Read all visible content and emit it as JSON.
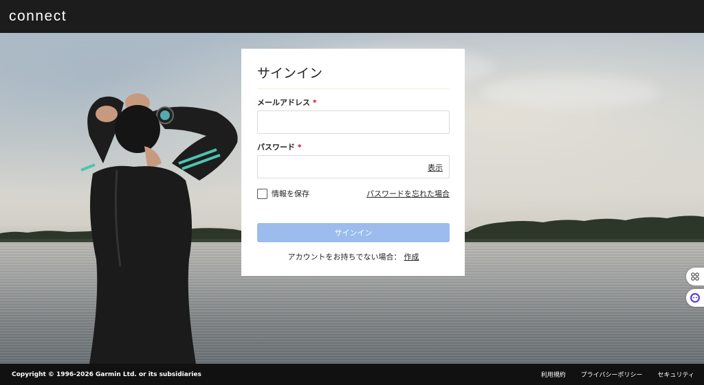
{
  "header": {
    "logo_text": "connect"
  },
  "signin": {
    "title": "サインイン",
    "email_label": "メールアドレス",
    "email_value": "",
    "password_label": "パスワード",
    "password_value": "",
    "required_mark": "*",
    "show_label": "表示",
    "remember_label": "情報を保存",
    "remember_checked": false,
    "forgot_label": "パスワードを忘れた場合",
    "button_label": "サインイン",
    "no_account_text": "アカウントをお持ちでない場合：",
    "create_label": "作成"
  },
  "footer": {
    "copyright": "Copyright © 1996-2026 Garmin Ltd. or its subsidiaries",
    "links": [
      "利用規約",
      "プライバシーポリシー",
      "セキュリティ"
    ]
  },
  "side_widgets": [
    "apps-grid-icon",
    "chat-assistant-icon"
  ],
  "colors": {
    "header_bg": "#1c1c1c",
    "button_disabled": "#9bbcec",
    "required": "#c8102e",
    "wetsuit_accent": "#4ec3b0"
  }
}
